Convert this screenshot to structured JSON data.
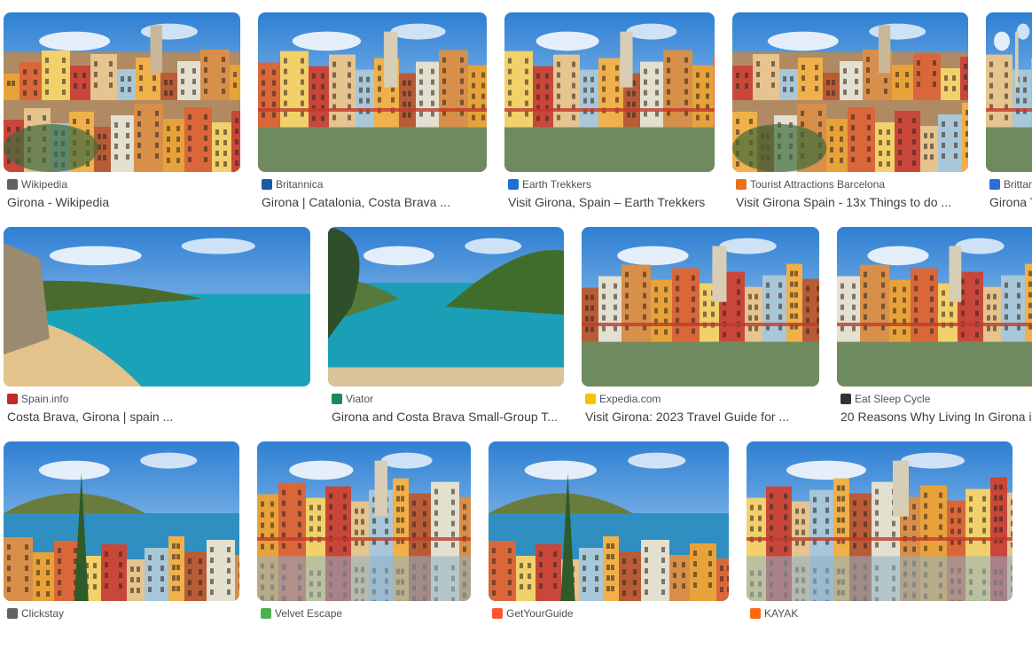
{
  "results": [
    {
      "source": "Wikipedia",
      "title": "Girona - Wikipedia",
      "favicon": "wikipedia-icon",
      "color": "#5f6368"
    },
    {
      "source": "Britannica",
      "title": "Girona | Catalonia, Costa Brava ...",
      "favicon": "britannica-icon",
      "color": "#1a5aa6"
    },
    {
      "source": "Earth Trekkers",
      "title": "Visit Girona, Spain – Earth Trekkers",
      "favicon": "earth-trekkers-icon",
      "color": "#1f6fd1"
    },
    {
      "source": "Tourist Attractions Barcelona",
      "title": "Visit Girona Spain - 13x Things to do ...",
      "favicon": "tourist-attractions-barcelona-icon",
      "color": "#e8711a"
    },
    {
      "source": "Brittan",
      "title": "Girona T",
      "favicon": "brittanica-partial-icon",
      "color": "#2a6fd6"
    },
    {
      "source": "Spain.info",
      "title": "Costa Brava, Girona | spain ...",
      "favicon": "spain-info-icon",
      "color": "#c62828"
    },
    {
      "source": "Viator",
      "title": "Girona and Costa Brava Small-Group T...",
      "favicon": "viator-icon",
      "color": "#1b8a5a"
    },
    {
      "source": "Expedia.com",
      "title": "Visit Girona: 2023 Travel Guide for ...",
      "favicon": "expedia-icon",
      "color": "#f5c400"
    },
    {
      "source": "Eat Sleep Cycle",
      "title": "20 Reasons Why Living In Girona i",
      "favicon": "eat-sleep-cycle-icon",
      "color": "#333333"
    },
    {
      "source": "Clickstay",
      "title": "",
      "favicon": "clickstay-icon",
      "color": "#5f6368"
    },
    {
      "source": "Velvet Escape",
      "title": "",
      "favicon": "velvet-escape-icon",
      "color": "#4caf50"
    },
    {
      "source": "GetYourGuide",
      "title": "",
      "favicon": "getyourguide-icon",
      "color": "#ff5533"
    },
    {
      "source": "KAYAK",
      "title": "",
      "favicon": "kayak-icon",
      "color": "#ff690f"
    }
  ]
}
